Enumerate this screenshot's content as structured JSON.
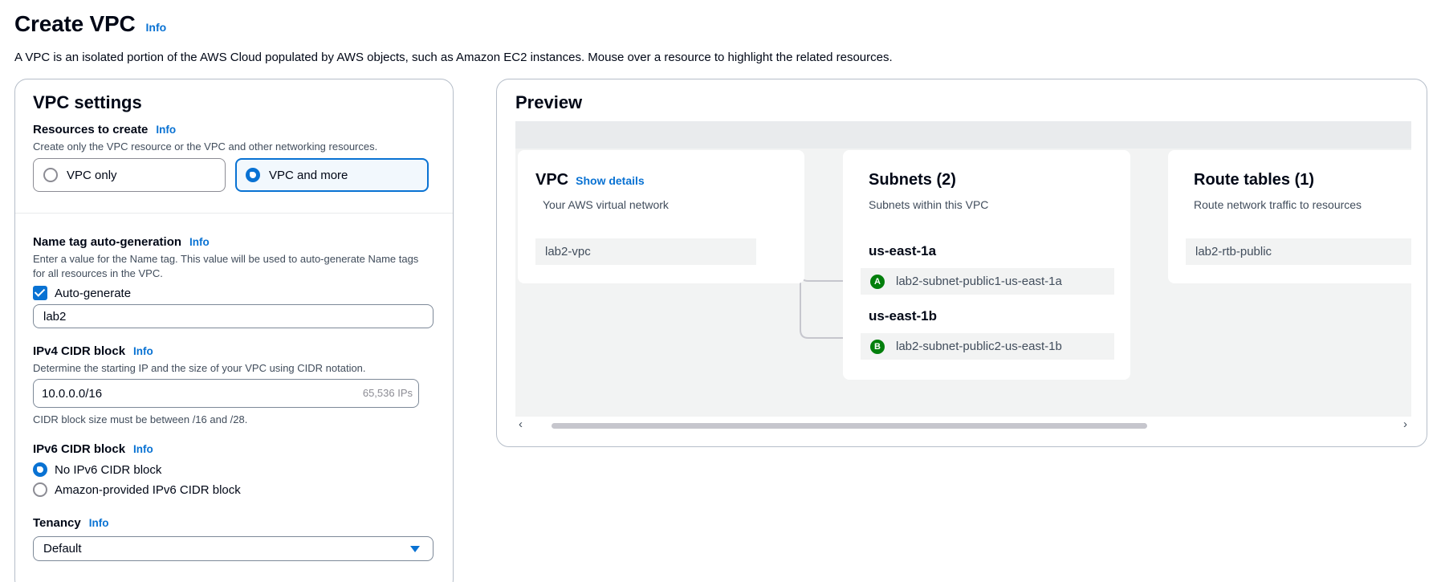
{
  "header": {
    "title": "Create VPC",
    "info": "Info",
    "description": "A VPC is an isolated portion of the AWS Cloud populated by AWS objects, such as Amazon EC2 instances. Mouse over a resource to highlight the related resources."
  },
  "settings": {
    "title": "VPC settings",
    "resources": {
      "label": "Resources to create",
      "info": "Info",
      "description": "Create only the VPC resource or the VPC and other networking resources.",
      "options": [
        "VPC only",
        "VPC and more"
      ],
      "selected": "VPC and more"
    },
    "name_tag": {
      "label": "Name tag auto-generation",
      "info": "Info",
      "description": "Enter a value for the Name tag. This value will be used to auto-generate Name tags for all resources in the VPC.",
      "checkbox_label": "Auto-generate",
      "checked": true,
      "value": "lab2"
    },
    "ipv4": {
      "label": "IPv4 CIDR block",
      "info": "Info",
      "description": "Determine the starting IP and the size of your VPC using CIDR notation.",
      "value": "10.0.0.0/16",
      "suffix": "65,536 IPs",
      "constraint": "CIDR block size must be between /16 and /28."
    },
    "ipv6": {
      "label": "IPv6 CIDR block",
      "info": "Info",
      "options": [
        "No IPv6 CIDR block",
        "Amazon-provided IPv6 CIDR block"
      ],
      "selected": "No IPv6 CIDR block"
    },
    "tenancy": {
      "label": "Tenancy",
      "info": "Info",
      "value": "Default"
    }
  },
  "preview": {
    "title": "Preview",
    "vpc": {
      "title": "VPC",
      "show_details": "Show details",
      "description": "Your AWS virtual network",
      "resource": "lab2-vpc"
    },
    "subnets": {
      "title": "Subnets (2)",
      "description": "Subnets within this VPC",
      "zones": [
        {
          "az": "us-east-1a",
          "badge": "A",
          "subnet": "lab2-subnet-public1-us-east-1a"
        },
        {
          "az": "us-east-1b",
          "badge": "B",
          "subnet": "lab2-subnet-public2-us-east-1b"
        }
      ]
    },
    "route_tables": {
      "title": "Route tables (1)",
      "description": "Route network traffic to resources",
      "resource": "lab2-rtb-public"
    },
    "scroll_left_icon": "chevron-left-icon",
    "scroll_right_icon": "chevron-right-icon",
    "colors": {
      "accent": "#0972d3",
      "az_badge": "#037f0c",
      "connector": "#c6c6cd"
    }
  }
}
